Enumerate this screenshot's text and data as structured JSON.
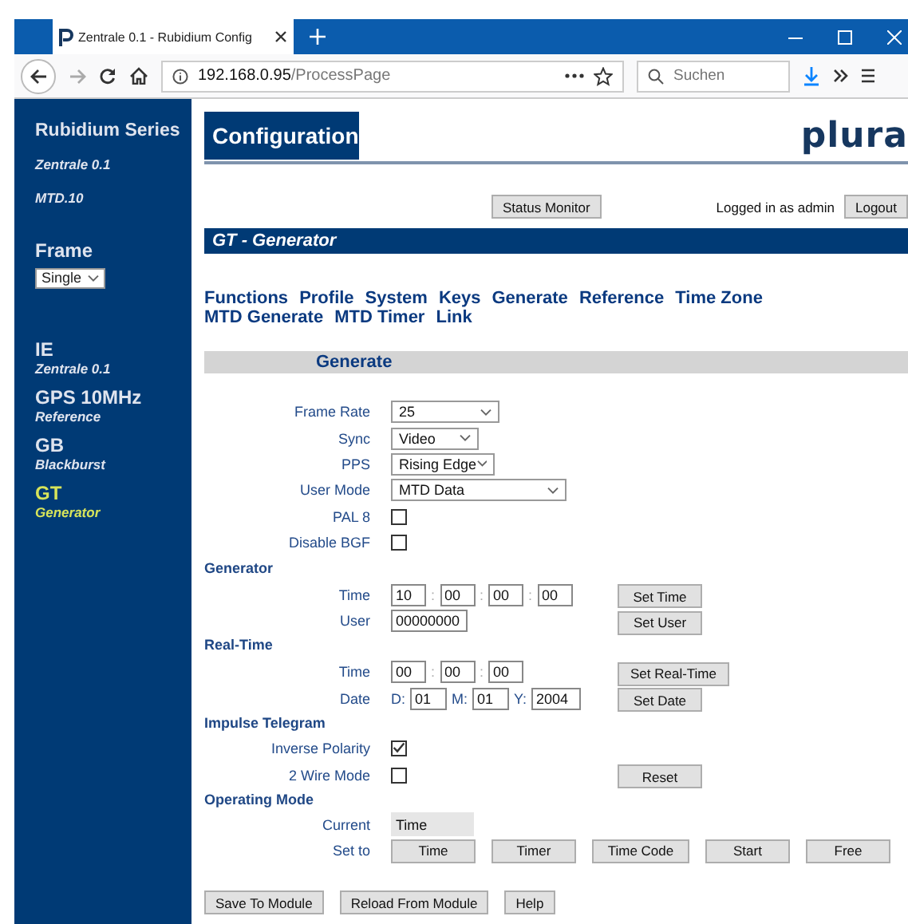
{
  "browser": {
    "tab_title": "Zentrale 0.1 - Rubidium Config",
    "address_host": "192.168.0.95",
    "address_path": "/ProcessPage",
    "search_placeholder": "Suchen"
  },
  "sidebar": {
    "title": "Rubidium Series",
    "device_lines": [
      "Zentrale 0.1",
      "MTD.10"
    ],
    "frame_label": "Frame",
    "frame_value": "Single",
    "modules": [
      {
        "name": "IE",
        "sub": "Zentrale 0.1",
        "selected": false
      },
      {
        "name": "GPS 10MHz",
        "sub": "Reference",
        "selected": false
      },
      {
        "name": "GB",
        "sub": "Blackburst",
        "selected": false
      },
      {
        "name": "GT",
        "sub": "Generator",
        "selected": true
      }
    ]
  },
  "header": {
    "title": "Configuration",
    "logo": "plura"
  },
  "status_button": "Status Monitor",
  "login_text": "Logged in as admin",
  "logout_button": "Logout",
  "page_title": "GT - Generator",
  "nav_lines": [
    [
      "Functions",
      "Profile",
      "System",
      "Keys",
      "Generate",
      "Reference",
      "Time Zone"
    ],
    [
      "MTD Generate",
      "MTD Timer",
      "Link"
    ]
  ],
  "section_title": "Generate",
  "rows": [
    {
      "kind": "select",
      "label": "Frame Rate",
      "value": "25"
    },
    {
      "kind": "select",
      "label": "Sync",
      "value": "Video"
    },
    {
      "kind": "select",
      "label": "PPS",
      "value": "Rising Edge"
    },
    {
      "kind": "select",
      "label": "User Mode",
      "value": "MTD Data"
    },
    {
      "kind": "checkbox",
      "label": "PAL 8",
      "checked": false
    },
    {
      "kind": "checkbox",
      "label": "Disable BGF",
      "checked": false
    },
    {
      "kind": "heading",
      "label": "Generator"
    },
    {
      "kind": "time",
      "label": "Time",
      "values": [
        "10",
        "00",
        "00",
        "00"
      ],
      "separators": [
        ":",
        ":",
        ":"
      ],
      "button": "Set Time"
    },
    {
      "kind": "text",
      "label": "User",
      "value": "00000000",
      "button": "Set User"
    },
    {
      "kind": "heading",
      "label": "Real-Time"
    },
    {
      "kind": "time",
      "label": "Time",
      "values": [
        "00",
        "00",
        "00"
      ],
      "separators": [
        ":",
        ":"
      ],
      "button": "Set Real-Time"
    },
    {
      "kind": "date",
      "label": "Date",
      "parts": [
        {
          "prefix": "D:",
          "value": "01"
        },
        {
          "prefix": "M:",
          "value": "01"
        },
        {
          "prefix": "Y:",
          "value": "2004"
        }
      ],
      "button": "Set Date"
    },
    {
      "kind": "heading",
      "label": "Impulse Telegram"
    },
    {
      "kind": "checkbox",
      "label": "Inverse Polarity",
      "checked": true
    },
    {
      "kind": "checkbox",
      "label": "2 Wire Mode",
      "checked": false,
      "button": "Reset"
    },
    {
      "kind": "heading",
      "label": "Operating Mode"
    },
    {
      "kind": "readonly",
      "label": "Current",
      "value": "Time"
    },
    {
      "kind": "buttons",
      "label": "Set to",
      "buttons": [
        "Time",
        "Timer",
        "Time Code",
        "Start",
        "Free"
      ]
    }
  ],
  "footer_buttons": [
    "Save To Module",
    "Reload From Module",
    "Help"
  ]
}
